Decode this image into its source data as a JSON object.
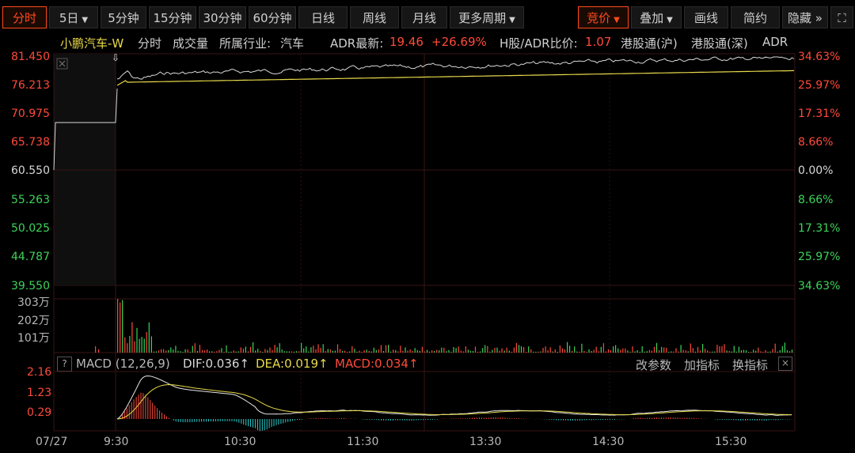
{
  "toolbar": {
    "intraday": "分时",
    "day5": "5日",
    "min5": "5分钟",
    "min15": "15分钟",
    "min30": "30分钟",
    "min60": "60分钟",
    "daily": "日线",
    "weekly": "周线",
    "monthly": "月线",
    "more": "更多周期",
    "auction": "竞价",
    "overlay": "叠加",
    "draw": "画线",
    "simple": "简约",
    "hide": "隐藏",
    "hide_arrows": "»",
    "fullscreen": "⛶"
  },
  "info": {
    "name": "小鹏汽车-W",
    "mode": "分时",
    "volume": "成交量",
    "industry_label": "所属行业:",
    "industry": "汽车",
    "adr_label": "ADR最新:",
    "adr_price": "19.46",
    "adr_change": "+26.69%",
    "ratio_label": "H股/ADR比价:",
    "ratio": "1.07",
    "hk_sh": "港股通(沪)",
    "hk_sz": "港股通(深)",
    "adr": "ADR"
  },
  "price_axis": {
    "left": [
      "81.450",
      "76.213",
      "70.975",
      "65.738",
      "60.550",
      "55.263",
      "50.025",
      "44.787",
      "39.550"
    ],
    "right": [
      "34.63%",
      "25.97%",
      "17.31%",
      "8.66%",
      "0.00%",
      "8.66%",
      "17.31%",
      "25.97%",
      "34.63%"
    ]
  },
  "volume_axis": [
    "303万",
    "202万",
    "101万"
  ],
  "macd": {
    "help": "?",
    "title": "MACD (12,26,9)",
    "dif": "DIF:0.036↑",
    "dea": "DEA:0.019↑",
    "macd": "MACD:0.034↑",
    "edit_params": "改参数",
    "add_indicator": "加指标",
    "switch_indicator": "换指标",
    "close": "×",
    "axis": [
      "2.16",
      "1.23",
      "0.29"
    ]
  },
  "time_axis": [
    "07/27",
    "9:30",
    "10:30",
    "11:30",
    "13:30",
    "14:30",
    "15:30"
  ],
  "colors": {
    "up": "#ff4a3a",
    "down": "#3dd35a",
    "avg_line": "#e8d94a",
    "price_line": "#d8d8d8",
    "accent": "#ff4a1c"
  }
}
